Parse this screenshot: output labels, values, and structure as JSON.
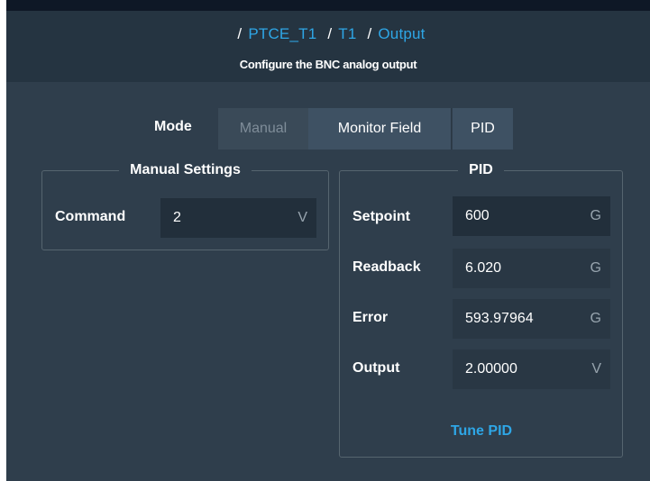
{
  "header": {
    "breadcrumb": [
      {
        "sep": "/",
        "label": "PTCE_T1"
      },
      {
        "sep": "/",
        "label": "T1"
      },
      {
        "sep": "/",
        "label": "Output"
      }
    ],
    "subtitle": "Configure the BNC analog output"
  },
  "mode": {
    "label": "Mode",
    "options": [
      "Manual",
      "Monitor Field",
      "PID"
    ],
    "disabled": "Manual"
  },
  "manual_settings": {
    "title": "Manual Settings",
    "command_label": "Command",
    "command_value": "2",
    "command_unit": "V"
  },
  "pid": {
    "title": "PID",
    "rows": [
      {
        "label": "Setpoint",
        "value": "600",
        "unit": "G"
      },
      {
        "label": "Readback",
        "value": "6.020",
        "unit": "G"
      },
      {
        "label": "Error",
        "value": "593.97964",
        "unit": "G"
      },
      {
        "label": "Output",
        "value": "2.00000",
        "unit": "V"
      }
    ],
    "tune_label": "Tune PID"
  },
  "colors": {
    "accent": "#2ea6e6",
    "panel": "#2f3e4c",
    "header": "#253441",
    "field": "#222f3b"
  }
}
